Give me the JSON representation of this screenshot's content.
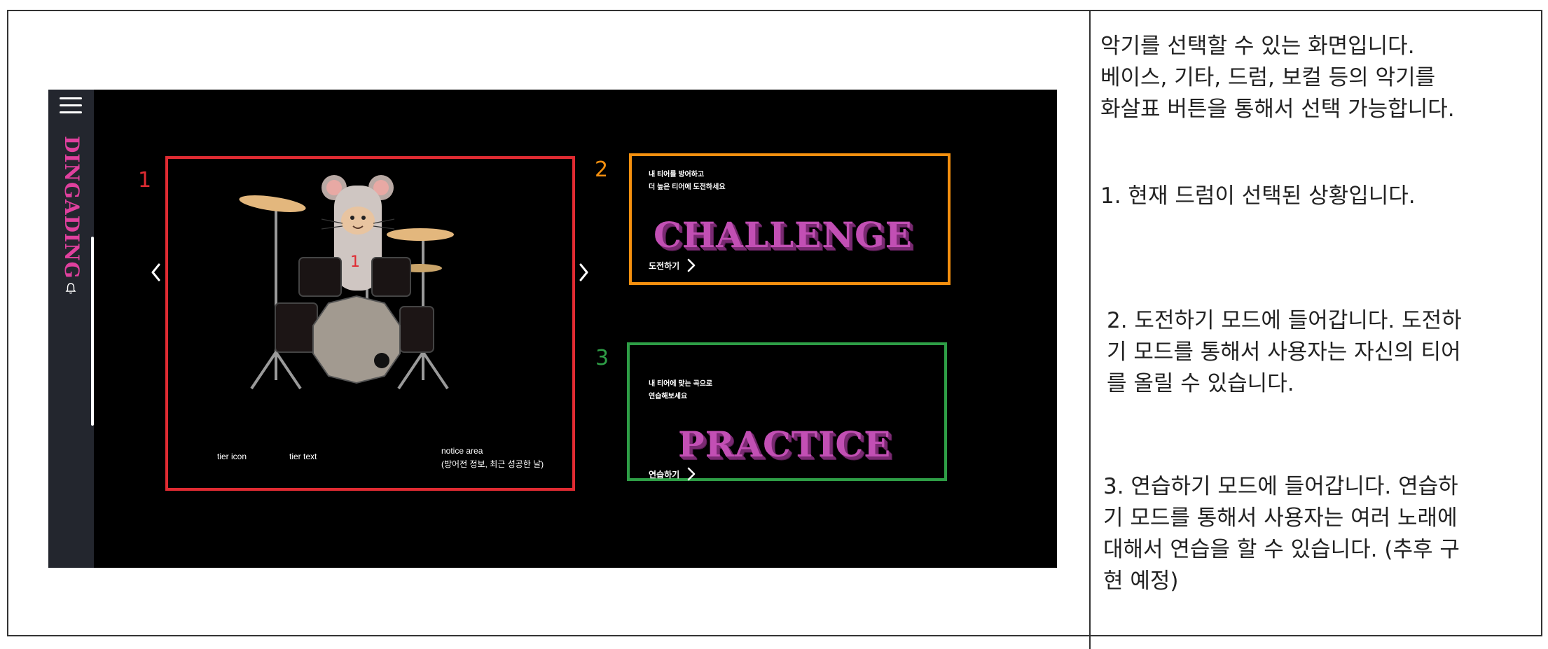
{
  "app": {
    "brand": "DINGADING"
  },
  "selection_panel": {
    "annotation_number": "1",
    "drum_marker": "1",
    "tier_icon_label": "tier icon",
    "tier_text_label": "tier text",
    "notice_line1": "notice area",
    "notice_line2": "(방어전 정보, 최근 성공한 날)",
    "prev_icon": "chevron-left-icon",
    "next_icon": "chevron-right-icon"
  },
  "challenge_card": {
    "annotation_number": "2",
    "subtitle_line1": "내 티어를 방어하고",
    "subtitle_line2": "더 높은 티어에 도전하세요",
    "title": "CHALLENGE",
    "button_label": "도전하기"
  },
  "practice_card": {
    "annotation_number": "3",
    "subtitle_line1": "내 티어에 맞는 곡으로",
    "subtitle_line2": "연습해보세요",
    "title": "PRACTICE",
    "button_label": "연습하기"
  },
  "notes": {
    "intro": [
      "악기를 선택할 수 있는 화면입니다.",
      "베이스, 기타, 드럼, 보컬 등의 악기를",
      "화살표 버튼을 통해서 선택 가능합니다."
    ],
    "note1": "1. 현재 드럼이 선택된 상황입니다.",
    "note2": [
      "2. 도전하기 모드에 들어갑니다. 도전하",
      "기 모드를 통해서 사용자는 자신의 티어",
      "를 올릴 수 있습니다."
    ],
    "note3": [
      "3. 연습하기 모드에 들어갑니다. 연습하",
      "기 모드를 통해서 사용자는 여러 노래에",
      "대해서 연습을 할 수 있습니다. (추후 구",
      "현 예정)"
    ]
  },
  "colors": {
    "annotation_red": "#e02b32",
    "annotation_orange": "#f5900f",
    "annotation_green": "#2e9e46",
    "brand_pink": "#e0409e",
    "title_magenta": "#c24fb4"
  }
}
